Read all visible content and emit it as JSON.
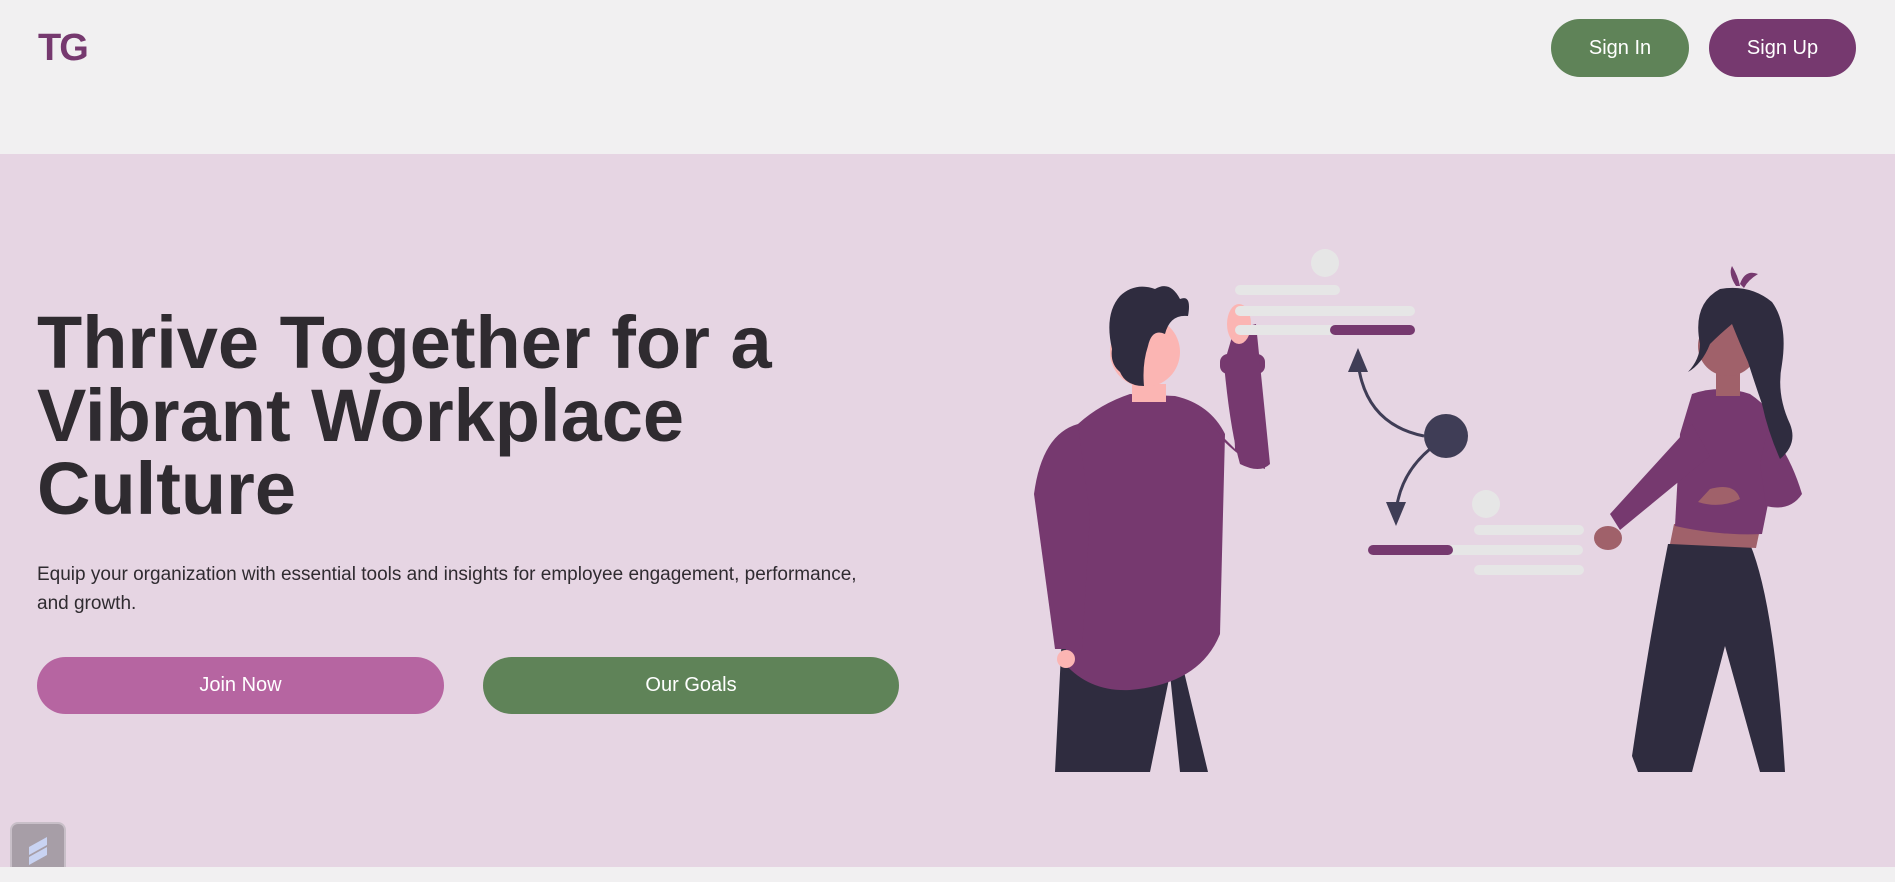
{
  "header": {
    "logo_text": "TG",
    "sign_in_label": "Sign In",
    "sign_up_label": "Sign Up"
  },
  "hero": {
    "headline": "Thrive Together for a Vibrant Workplace Culture",
    "subtext": "Equip your organization with essential tools and insights for employee engagement, performance, and growth.",
    "join_label": "Join Now",
    "goals_label": "Our Goals",
    "illustration_icon": "team-collaboration-illustration"
  },
  "widget": {
    "icon": "app-widget-icon"
  },
  "colors": {
    "brand_purple": "#76396f",
    "accent_pink": "#b665a1",
    "accent_green": "#5f8358",
    "hero_background": "#e6d5e3",
    "page_background": "#f1f0f1",
    "text_dark": "#2f2b30"
  }
}
